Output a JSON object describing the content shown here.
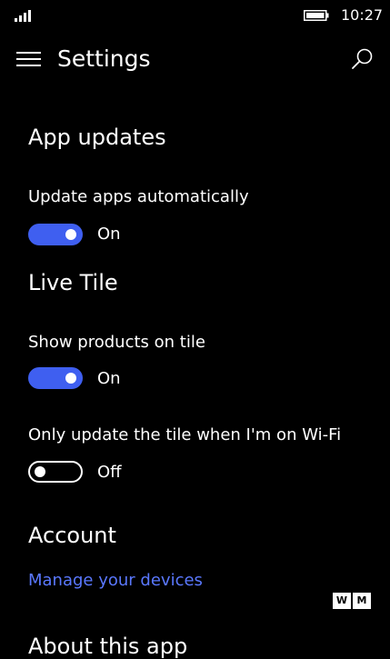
{
  "status_bar": {
    "time": "10:27",
    "signal_icon": "signal-strength-icon",
    "battery_icon": "battery-icon"
  },
  "header": {
    "title": "Settings",
    "menu_icon": "hamburger-menu-icon",
    "search_icon": "search-icon"
  },
  "sections": {
    "app_updates": {
      "title": "App updates",
      "update_apps": {
        "label": "Update apps automatically",
        "state": "On"
      }
    },
    "live_tile": {
      "title": "Live Tile",
      "show_products": {
        "label": "Show products on tile",
        "state": "On"
      },
      "wifi_only": {
        "label": "Only update the tile when I'm on Wi-Fi",
        "state": "Off"
      }
    },
    "account": {
      "title": "Account",
      "manage_link": "Manage your devices"
    },
    "about": {
      "title": "About this app"
    }
  },
  "colors": {
    "accent": "#3f5ff0",
    "link": "#5a78ff",
    "background": "#000000",
    "text": "#ffffff"
  },
  "watermark": {
    "letters": [
      "W",
      "M"
    ]
  }
}
